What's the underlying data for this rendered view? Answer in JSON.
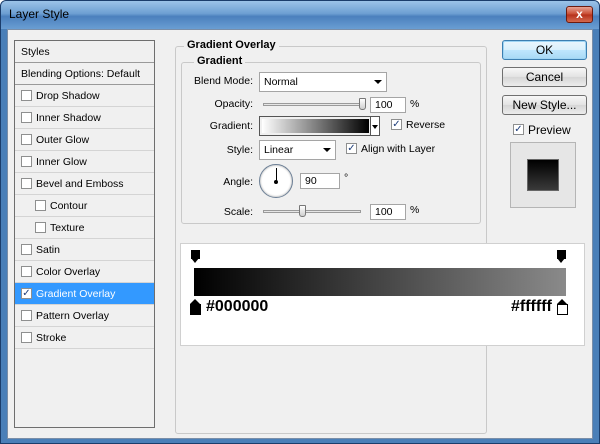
{
  "window": {
    "title": "Layer Style",
    "close_glyph": "x"
  },
  "sidebar": {
    "header": "Styles",
    "blending": "Blending Options: Default",
    "items": [
      {
        "label": "Drop Shadow",
        "checked": false,
        "indent": false
      },
      {
        "label": "Inner Shadow",
        "checked": false,
        "indent": false
      },
      {
        "label": "Outer Glow",
        "checked": false,
        "indent": false
      },
      {
        "label": "Inner Glow",
        "checked": false,
        "indent": false
      },
      {
        "label": "Bevel and Emboss",
        "checked": false,
        "indent": false
      },
      {
        "label": "Contour",
        "checked": false,
        "indent": true
      },
      {
        "label": "Texture",
        "checked": false,
        "indent": true
      },
      {
        "label": "Satin",
        "checked": false,
        "indent": false
      },
      {
        "label": "Color Overlay",
        "checked": false,
        "indent": false
      },
      {
        "label": "Gradient Overlay",
        "checked": true,
        "indent": false,
        "selected": true
      },
      {
        "label": "Pattern Overlay",
        "checked": false,
        "indent": false
      },
      {
        "label": "Stroke",
        "checked": false,
        "indent": false
      }
    ]
  },
  "panel": {
    "outer_title": "Gradient Overlay",
    "inner_title": "Gradient",
    "blend_mode": {
      "label": "Blend Mode:",
      "value": "Normal"
    },
    "opacity": {
      "label": "Opacity:",
      "value": "100",
      "unit": "%",
      "level": 1.0
    },
    "gradient": {
      "label": "Gradient:",
      "reverse_label": "Reverse",
      "reverse_checked": true
    },
    "style": {
      "label": "Style:",
      "value": "Linear",
      "align_label": "Align with Layer",
      "align_checked": true
    },
    "angle": {
      "label": "Angle:",
      "value": "90",
      "unit": "°"
    },
    "scale": {
      "label": "Scale:",
      "value": "100",
      "unit": "%",
      "level": 0.4
    }
  },
  "editor": {
    "left_color": "#000000",
    "right_color": "#ffffff"
  },
  "buttons": {
    "ok": "OK",
    "cancel": "Cancel",
    "new_style": "New Style...",
    "preview_label": "Preview",
    "preview_checked": true
  },
  "colors": {
    "selected_bg": "#3399ff",
    "gradient_start": "#000000",
    "gradient_end": "#ffffff"
  }
}
